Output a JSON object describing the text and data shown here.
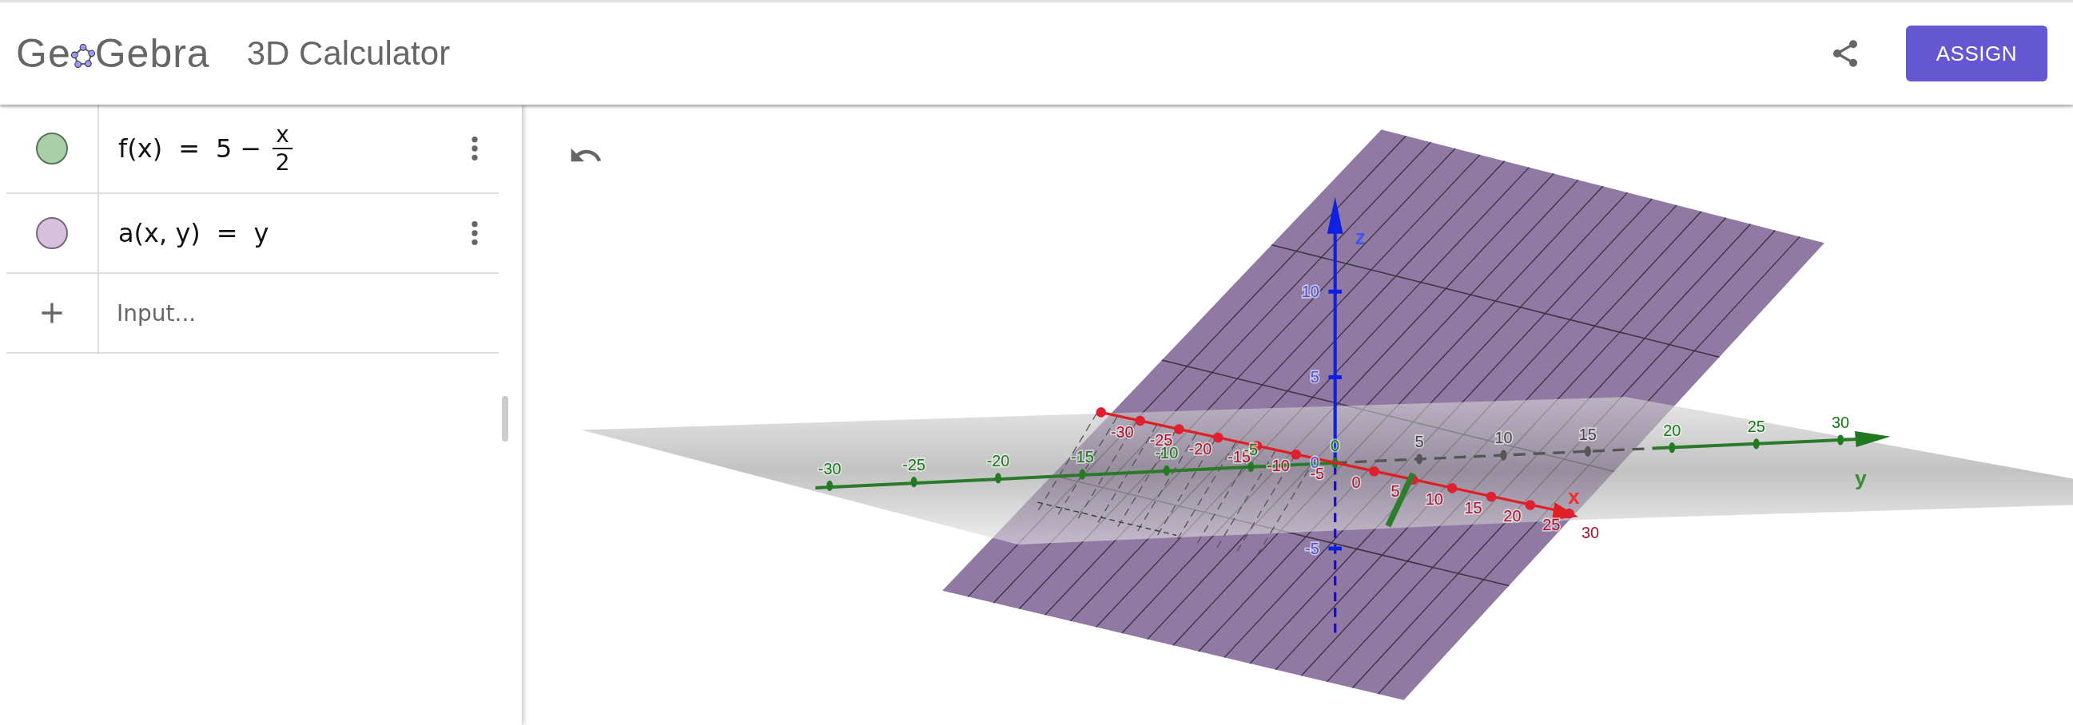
{
  "header": {
    "logo_start": "Ge",
    "logo_end": "Gebra",
    "title": "3D Calculator",
    "button": "ASSIGN"
  },
  "algebra": {
    "items": [
      {
        "kind": "fraction",
        "color": "#a9cfa9",
        "visible": true,
        "lhs": "f(x)",
        "equals": "=",
        "before": "5 −",
        "numerator": "x",
        "denominator": "2"
      },
      {
        "kind": "plain",
        "color": "#d7bfdd",
        "visible": true,
        "lhs": "a(x, y)",
        "equals": "=",
        "before": "y"
      }
    ],
    "input_placeholder": "Input..."
  },
  "view": {
    "x_axis": {
      "label": "x",
      "ticks": [
        "-30",
        "-25",
        "-20",
        "-15",
        "-10",
        "-5",
        "0",
        "5",
        "10",
        "15",
        "20",
        "25",
        "30"
      ]
    },
    "y_axis": {
      "label": "y",
      "ticks": [
        {
          "label": "-30",
          "hidden": false
        },
        {
          "label": "-25",
          "hidden": false
        },
        {
          "label": "-20",
          "hidden": false
        },
        {
          "label": "-15",
          "hidden": false
        },
        {
          "label": "-10",
          "hidden": false
        },
        {
          "label": "-5",
          "hidden": false
        },
        {
          "label": "0",
          "hidden": false
        },
        {
          "label": "5",
          "hidden": true
        },
        {
          "label": "10",
          "hidden": true
        },
        {
          "label": "15",
          "hidden": true
        },
        {
          "label": "20",
          "hidden": false
        },
        {
          "label": "25",
          "hidden": false
        },
        {
          "label": "30",
          "hidden": false
        }
      ]
    },
    "z_axis": {
      "label": "z",
      "ticks": [
        "10",
        "5",
        "0",
        "-5"
      ]
    }
  }
}
